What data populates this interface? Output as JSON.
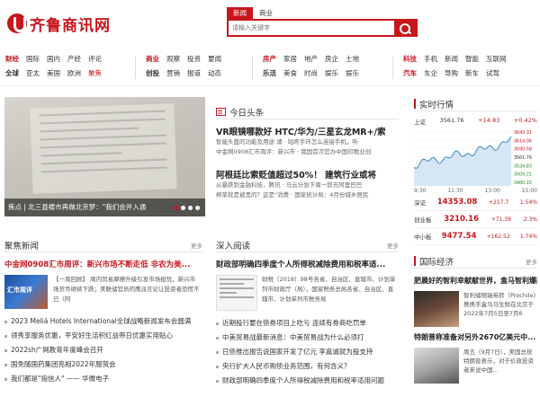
{
  "site": {
    "name": "齐鲁商讯网"
  },
  "search": {
    "tabs": [
      "新闻",
      "商业"
    ],
    "active_tab": 0,
    "placeholder": "请输入关键字"
  },
  "nav": {
    "group1": [
      "财经",
      "国际",
      "国内",
      "产经",
      "评论",
      "全球",
      "亚太",
      "美国",
      "欧洲",
      "聚焦"
    ],
    "group2": [
      "商业",
      "观察",
      "投资",
      "要闻",
      "",
      "创投",
      "营销",
      "报道",
      "动态",
      ""
    ],
    "group3": [
      "房产",
      "家居",
      "地产",
      "房企",
      "土地",
      "乐活",
      "美食",
      "时尚",
      "娱乐",
      "娱乐"
    ],
    "group4": [
      "科技",
      "手机",
      "新闻",
      "智能",
      "互联网",
      "汽车",
      "车企",
      "导购",
      "新车",
      "试驾"
    ]
  },
  "hero": {
    "caption": "焦点 | 北三县楼市再做北京梦：\"我们会并入通",
    "dots": 4,
    "active_dot": 0
  },
  "today": {
    "title": "今日头条",
    "items": [
      {
        "headline": "VR眼镜哪款好 HTC/华为/三星玄龙MR+/索",
        "desc": "智能头盔的功能及用途 请  ·  咕咚手环怎么连接手机，听"
      },
      {
        "headline": "",
        "desc": "中金网0908汇市周评：新兴市  ·  我国首次官办中国印歌业创"
      },
      {
        "headline": "阿根廷比索贬值超过50%！ 建筑行业或将",
        "desc": "从暴跌到金融科技，腾讯  ·  马云计划下周一辞去阿里巴巴"
      },
      {
        "headline": "",
        "desc": "榨菜就是被黑的？这是\"消费  ·  国家统计局：4月份城乡居民"
      }
    ]
  },
  "focus": {
    "title": "聚焦新闻",
    "more": "更多",
    "lead": "中金网0908汇市周评：新兴市场不断走低 非农为美...",
    "thumb_label": "汇市周评",
    "card_desc": "【一周回顾】    周内贸易摩擦升级引发市场担忧，新兴市场货币继续下跌；美联储官员的鹰派言论让投资者恐慌不已（阿",
    "list": [
      "2023 Meliá Hotels International全球战略新闻发布会圆满",
      "领秀享服务优惠，平安好生活积红益带日优惠实用贴心",
      "2022sh广网教育年度峰会召开",
      "国免随国药集团亮相2022年服贸会",
      "我们都是\"指信人\" —— 华微电子"
    ]
  },
  "deep": {
    "title": "深入阅读",
    "more": "更多",
    "lead": "财政部明确四季度个人所得税减除费用和税率适...",
    "card_desc": "财税〔2018〕98号各省、自治区、直辖市、计划单列市财政厅（局），国家税务总局各省、自治区、直辖市、计划单列市税务局",
    "list": [
      "近期投行要在债券项目上吃亏 连续有券商吃罚单",
      "中美贸易战最新消息：中美贸易战为什么必须打",
      "日债推出报告说国家开发了亿元 李嘉诚就为投支持",
      "央行扩大人民币购债业务范围，有何含义？",
      "财政部明确四季度个人所得税减除费用和税率适用问题"
    ]
  },
  "market": {
    "title": "实时行情",
    "label": "上证",
    "price": "3561.76",
    "change": "+14.83",
    "pct": "+0.42%",
    "y_ticks": [
      "3643.31",
      "3614.06",
      "3590.58",
      "3561.76",
      "3534.83",
      "3509.21",
      "3480.22"
    ],
    "x_ticks": [
      "9:30",
      "11:30",
      "13:00",
      "15:00"
    ],
    "indices": [
      {
        "name": "深证",
        "value": "14353.08",
        "change": "+217.7",
        "pct": "1.54%"
      },
      {
        "name": "创业板",
        "value": "3210.16",
        "change": "+71.39",
        "pct": "2.3%"
      },
      {
        "name": "中小板",
        "value": "9477.54",
        "change": "+162.52",
        "pct": "1.74%"
      }
    ],
    "colors": {
      "up": "#c8161d",
      "line": "#3a89c9"
    }
  },
  "intl": {
    "title": "国际经济",
    "more": "更多",
    "lead": "肥晨好的智利幸献献世界，盒马智利爆款",
    "card1": "智利储物瑞英转（Prochile）携携手盒马马生鲜在北京于2022年7月5日至7月6",
    "lead2": "特朗普称准备对另外2670亿美元中...",
    "card2": "周五（9月7日），美国总统特朗普表示，对于价政投资者来说中国..."
  }
}
